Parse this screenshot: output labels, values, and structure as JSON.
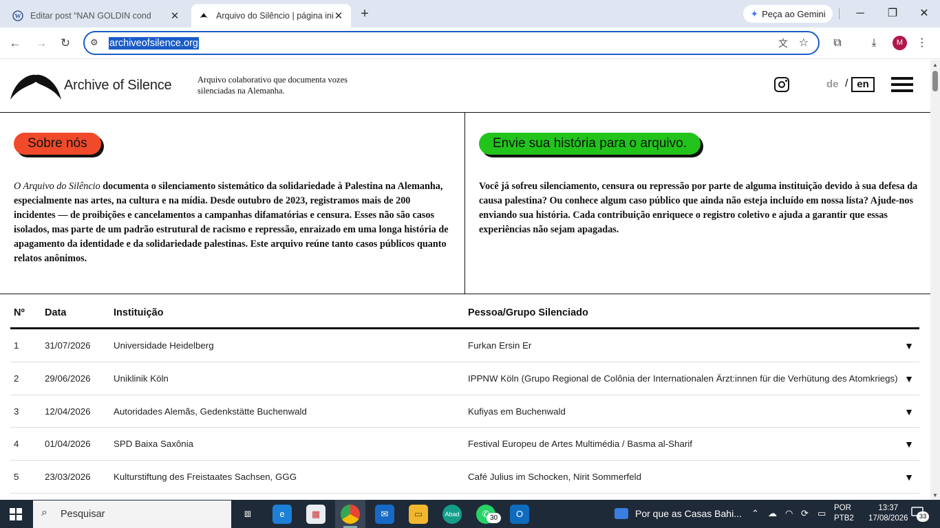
{
  "browser": {
    "tabs": [
      {
        "title": "Editar post “NAN GOLDIN cond",
        "icon": "wordpress-icon"
      },
      {
        "title": "Arquivo do Silêncio | página ini",
        "icon": "archive-logo-icon"
      }
    ],
    "gemini_label": "Peça ao Gemini",
    "url": "archiveofsilence.org",
    "profile_initial": "M"
  },
  "site": {
    "logo_text": "Archive of Silence",
    "tagline": "Arquivo colaborativo que documenta vozes silenciadas na Alemanha.",
    "lang_de": "de",
    "lang_sep": "/",
    "lang_en": "en"
  },
  "intro": {
    "about_button": "Sobre nós",
    "about_em": "O Arquivo do Silêncio",
    "about_text": " documenta o silenciamento sistemático da solidariedade à Palestina na Alemanha, especialmente nas artes, na cultura e na mídia. Desde outubro de 2023, registramos mais de 200 incidentes — de proibições e cancelamentos a campanhas difamatórias e censura. Esses não são casos isolados, mas parte de um padrão estrutural de racismo e repressão, enraizado em uma longa história de apagamento da identidade e da solidariedade palestinas. Este arquivo reúne tanto casos públicos quanto relatos anônimos.",
    "submit_button": "Envie sua história para o arquivo.",
    "submit_text": "Você já sofreu silenciamento, censura ou repressão por parte de alguma instituição devido à sua defesa da causa palestina? Ou conhece algum caso público que ainda não esteja incluído em nossa lista? Ajude-nos enviando sua história. Cada contribuição enriquece o registro coletivo e ajuda a garantir que essas experiências não sejam apagadas."
  },
  "table": {
    "headers": {
      "num": "Nº",
      "date": "Data",
      "institution": "Instituição",
      "person": "Pessoa/Grupo Silenciado"
    },
    "rows": [
      {
        "num": "1",
        "date": "31/07/2026",
        "institution": "Universidade Heidelberg",
        "person": "Furkan Ersin Er"
      },
      {
        "num": "2",
        "date": "29/06/2026",
        "institution": "Uniklinik Köln",
        "person": "IPPNW Köln (Grupo Regional de Colônia der Internationalen Ärzt:innen für die Verhütung des Atomkriegs)"
      },
      {
        "num": "3",
        "date": "12/04/2026",
        "institution": "Autoridades Alemãs, Gedenkstätte Buchenwald",
        "person": "Kufiyas em Buchenwald"
      },
      {
        "num": "4",
        "date": "01/04/2026",
        "institution": "SPD Baixa Saxônia",
        "person": "Festival Europeu de Artes Multimédia / Basma al-Sharif"
      },
      {
        "num": "5",
        "date": "23/03/2026",
        "institution": "Kulturstiftung des Freistaates Sachsen, GGG",
        "person": "Café Julius im Schocken, Nirit Sommerfeld"
      }
    ],
    "expand_glyph": "▼"
  },
  "taskbar": {
    "search_placeholder": "Pesquisar",
    "whatsapp_badge": "30",
    "news_text": "Por que as Casas Bahi...",
    "lang_line1": "POR",
    "lang_line2": "PTB2",
    "time": "13:37",
    "date": "17/08/2026",
    "notification_count": "33"
  },
  "colors": {
    "about_pill": "#f04a2a",
    "submit_pill": "#22c41c",
    "url_highlight": "#1a5cc8"
  }
}
